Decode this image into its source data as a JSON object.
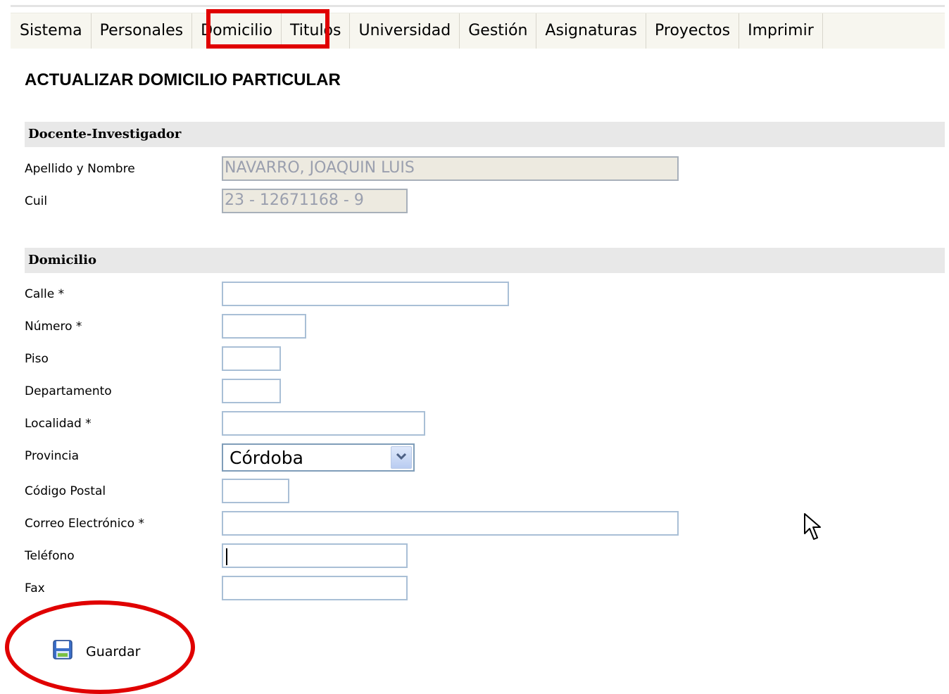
{
  "menu": {
    "items": [
      {
        "label": "Sistema"
      },
      {
        "label": "Personales"
      },
      {
        "label": "Domicilio"
      },
      {
        "label": "Titulos"
      },
      {
        "label": "Universidad"
      },
      {
        "label": "Gestión"
      },
      {
        "label": "Asignaturas"
      },
      {
        "label": "Proyectos"
      },
      {
        "label": "Imprimir"
      }
    ],
    "active": "Domicilio"
  },
  "page": {
    "title": "ACTUALIZAR DOMICILIO PARTICULAR"
  },
  "docente_section": {
    "header": "Docente-Investigador",
    "apellido_label": "Apellido y Nombre",
    "apellido_value": "NAVARRO, JOAQUIN LUIS",
    "cuil_label": "Cuil",
    "cuil_value": "23 - 12671168 - 9"
  },
  "domicilio_section": {
    "header": "Domicilio",
    "calle_label": "Calle *",
    "calle_value": "",
    "numero_label": "Número *",
    "numero_value": "",
    "piso_label": "Piso",
    "piso_value": "",
    "departamento_label": "Departamento",
    "departamento_value": "",
    "localidad_label": "Localidad *",
    "localidad_value": "",
    "provincia_label": "Provincia",
    "provincia_value": "Córdoba",
    "codigo_postal_label": "Código Postal",
    "codigo_postal_value": "",
    "correo_label": "Correo Electrónico *",
    "correo_value": "",
    "telefono_label": "Teléfono",
    "telefono_value": "",
    "fax_label": "Fax",
    "fax_value": ""
  },
  "actions": {
    "save_label": "Guardar",
    "save_icon": "floppy-disk-icon"
  },
  "colors": {
    "annotation": "#e00000",
    "menu_background": "#f7f6ef",
    "section_background": "#e8e8e8",
    "input_border": "#a9bfd6",
    "readonly_background": "#edeae0"
  }
}
